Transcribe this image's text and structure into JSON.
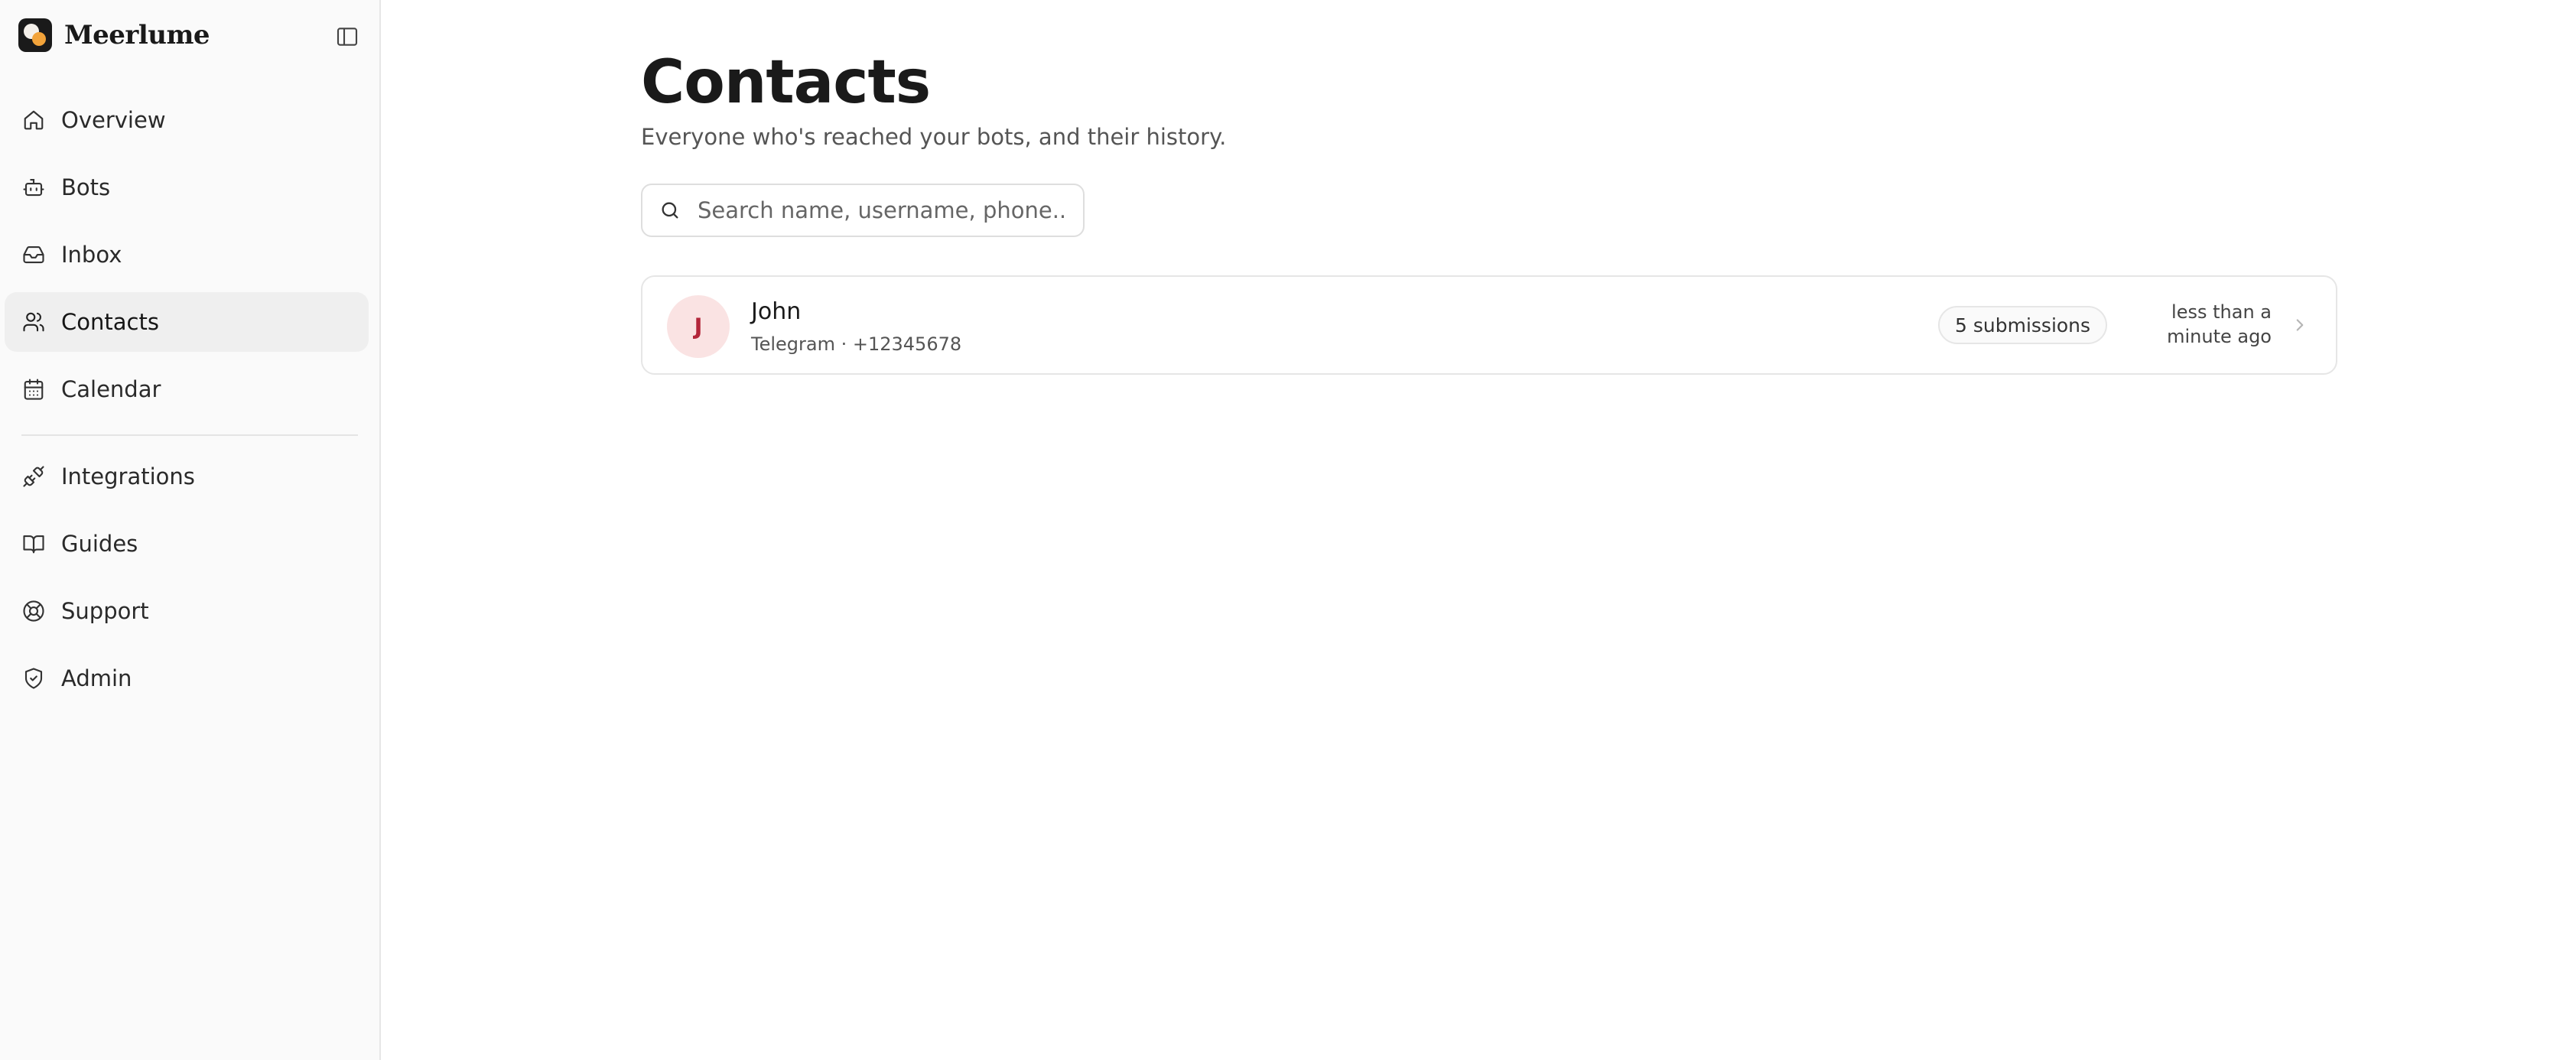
{
  "app": {
    "name": "Meerlume",
    "accent_color": "#f2a33a",
    "logo_icon": "app-logo-icon",
    "collapse_icon": "sidebar-toggle-icon"
  },
  "sidebar": {
    "items": [
      {
        "label": "Overview",
        "icon": "home-icon",
        "active": false
      },
      {
        "label": "Bots",
        "icon": "bot-icon",
        "active": false
      },
      {
        "label": "Inbox",
        "icon": "inbox-icon",
        "active": false
      },
      {
        "label": "Contacts",
        "icon": "users-icon",
        "active": true
      },
      {
        "label": "Calendar",
        "icon": "calendar-icon",
        "active": false
      },
      {
        "label": "Integrations",
        "icon": "plug-icon",
        "active": false
      },
      {
        "label": "Guides",
        "icon": "book-icon",
        "active": false
      },
      {
        "label": "Support",
        "icon": "life-buoy-icon",
        "active": false
      },
      {
        "label": "Admin",
        "icon": "shield-icon",
        "active": false
      }
    ]
  },
  "page": {
    "title": "Contacts",
    "subtitle": "Everyone who's reached your bots, and their history."
  },
  "search": {
    "placeholder": "Search name, username, phone...",
    "value": ""
  },
  "contacts": [
    {
      "initial": "J",
      "name": "John",
      "meta": "Telegram · +12345678",
      "submissions": "5 submissions",
      "last_seen_line1": "less than a",
      "last_seen_line2": "minute ago",
      "avatar_color": "#fae3e3",
      "initial_color": "#b3263a"
    }
  ]
}
